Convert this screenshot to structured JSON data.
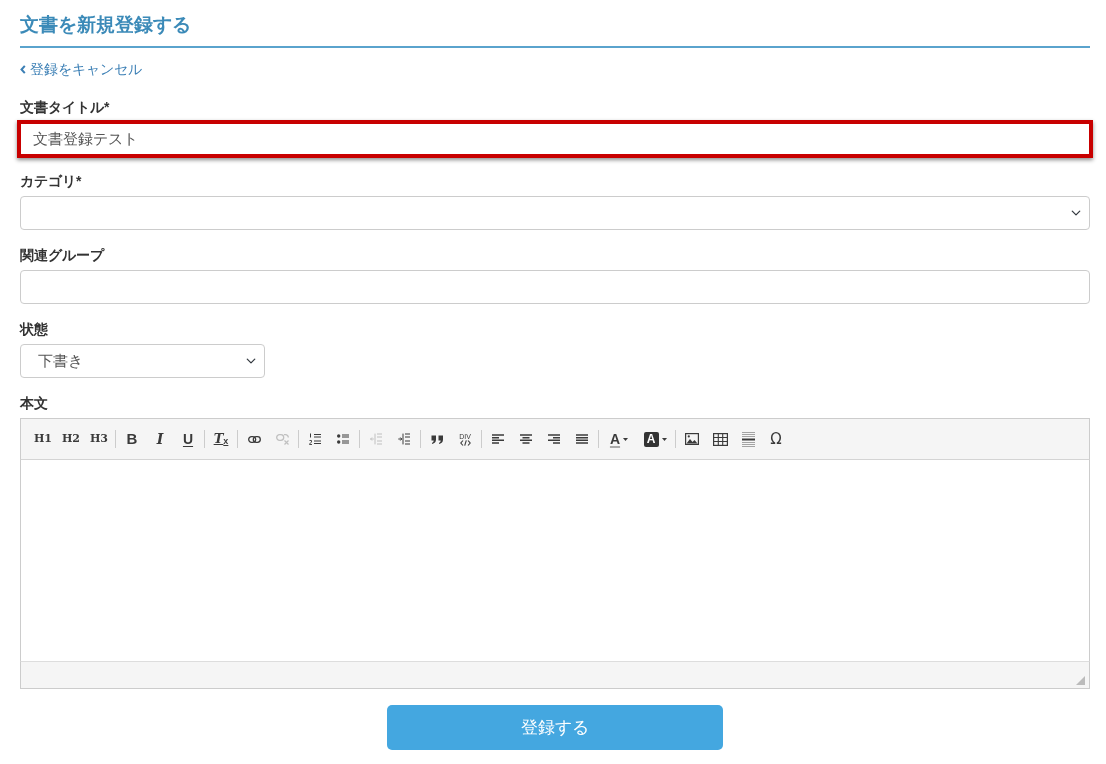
{
  "page": {
    "title": "文書を新規登録する"
  },
  "back_link": {
    "label": "登録をキャンセル"
  },
  "fields": [
    {
      "kind": "text",
      "label": "文書タイトル*",
      "value": "文書登録テスト",
      "highlighted": true,
      "compact": false
    },
    {
      "kind": "select",
      "label": "カテゴリ*",
      "highlighted": false,
      "compact": false
    },
    {
      "kind": "text",
      "label": "関連グループ",
      "highlighted": false,
      "compact": false
    },
    {
      "kind": "select",
      "label": "状態",
      "value": "下書き",
      "highlighted": false,
      "compact": true
    },
    {
      "kind": "editor",
      "label": "本文",
      "highlighted": false,
      "compact": false,
      "toolbar": [
        {
          "buttons": [
            {
              "kind": "heading",
              "label": "H1",
              "disabled": false
            },
            {
              "kind": "heading",
              "label": "H2",
              "disabled": false
            },
            {
              "kind": "heading",
              "label": "H3",
              "disabled": false
            }
          ]
        },
        {
          "buttons": [
            {
              "kind": "bold",
              "label": "B",
              "disabled": false
            },
            {
              "kind": "italic",
              "label": "I",
              "disabled": false
            },
            {
              "kind": "underline",
              "label": "U",
              "disabled": false
            }
          ]
        },
        {
          "buttons": [
            {
              "kind": "clearformat",
              "label": "T$_{x}$",
              "disabled": false
            }
          ]
        },
        {
          "buttons": [
            {
              "kind": "link",
              "disabled": false
            },
            {
              "kind": "unlink",
              "disabled": true
            }
          ]
        },
        {
          "buttons": [
            {
              "kind": "numbered",
              "disabled": false
            },
            {
              "kind": "bullets",
              "disabled": false
            }
          ]
        },
        {
          "buttons": [
            {
              "kind": "outdent",
              "disabled": true
            },
            {
              "kind": "indent",
              "disabled": false
            }
          ]
        },
        {
          "buttons": [
            {
              "kind": "quote",
              "disabled": false
            },
            {
              "kind": "div",
              "label": "DIV",
              "disabled": false
            }
          ]
        },
        {
          "buttons": [
            {
              "kind": "left",
              "disabled": false
            },
            {
              "kind": "center",
              "disabled": false
            },
            {
              "kind": "right",
              "disabled": false
            },
            {
              "kind": "justify",
              "disabled": false
            }
          ]
        },
        {
          "buttons": [
            {
              "kind": "forecolor",
              "label": "A",
              "disabled": false
            },
            {
              "kind": "backcolor",
              "label": "A",
              "disabled": false
            }
          ]
        },
        {
          "buttons": [
            {
              "kind": "image",
              "disabled": false
            },
            {
              "kind": "table",
              "disabled": false
            },
            {
              "kind": "rule",
              "disabled": false
            },
            {
              "kind": "symbol",
              "label": "Ω",
              "disabled": false
            }
          ]
        }
      ]
    }
  ],
  "submit": {
    "label": "登録する"
  }
}
